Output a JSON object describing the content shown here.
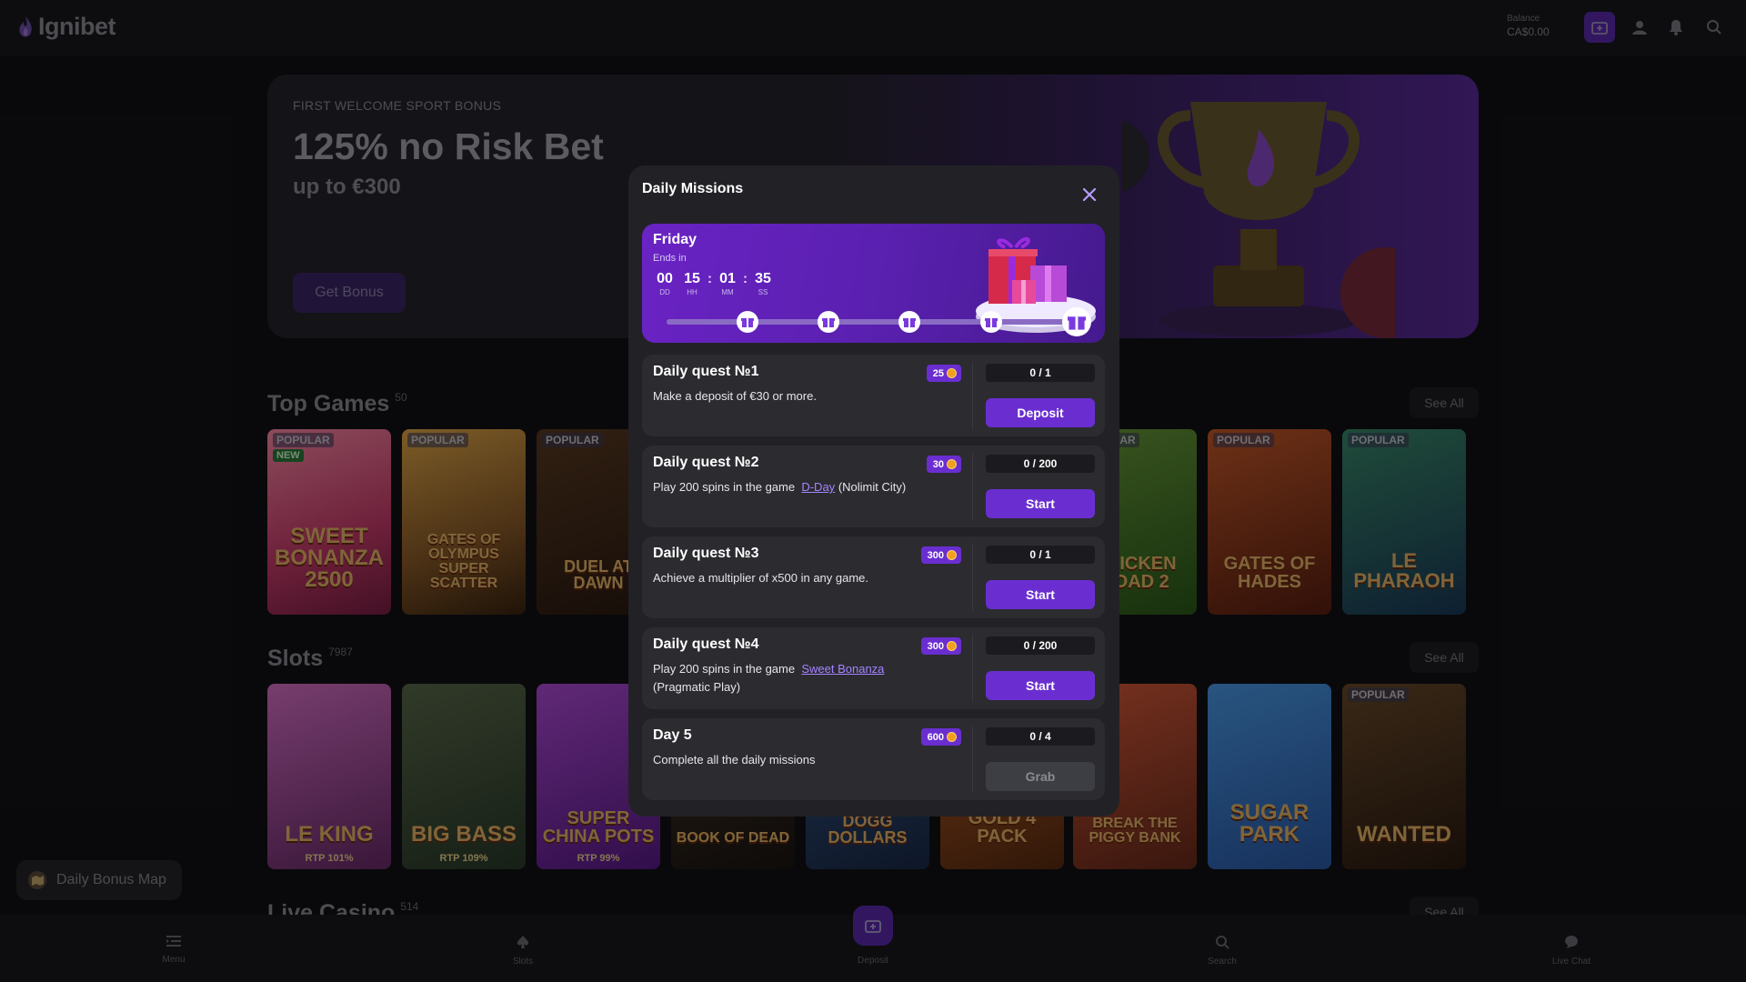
{
  "header": {
    "brand": "Ignibet",
    "balance_label": "Balance",
    "balance_value": "CA$0.00"
  },
  "banner": {
    "kicker": "FIRST WELCOME SPORT BONUS",
    "title": "125% no Risk Bet",
    "subtitle": "up to €300",
    "button": "Get Bonus"
  },
  "sections": {
    "top_games": {
      "title": "Top Games",
      "count": "50",
      "see_all": "See All"
    },
    "slots": {
      "title": "Slots",
      "count": "7987",
      "see_all": "See All"
    },
    "live_casino": {
      "title": "Live Casino",
      "count": "514",
      "see_all": "See All"
    }
  },
  "tiles": {
    "popular": "POPULAR",
    "new": "NEW",
    "top": [
      {
        "name": "SWEET BONANZA 2500"
      },
      {
        "name": "GATES OF OLYMPUS SUPER SCATTER"
      },
      {
        "name": "DUEL AT DAWN"
      },
      {
        "name": "CHICKEN ROAD 2"
      },
      {
        "name": "GATES OF HADES"
      },
      {
        "name": "LE PHARAOH"
      }
    ],
    "slots": [
      {
        "name": "LE KING",
        "rtp": "RTP 101%"
      },
      {
        "name": "BIG BASS",
        "rtp": "RTP 109%"
      },
      {
        "name": "SUPER CHINA POTS",
        "rtp": "RTP 99%"
      },
      {
        "name": "BOOK OF DEAD"
      },
      {
        "name": "DOGG DOLLARS"
      },
      {
        "name": "GOLD 4 PACK"
      },
      {
        "name": "BREAK THE PIGGY BANK"
      },
      {
        "name": "SUGAR PARK"
      },
      {
        "name": "WANTED"
      }
    ]
  },
  "daily_bonus_map": "Daily Bonus Map",
  "bottom_nav": {
    "menu": "Menu",
    "slots": "Slots",
    "deposit": "Deposit",
    "search": "Search",
    "live_chat": "Live Chat"
  },
  "modal": {
    "title": "Daily Missions",
    "day": "Friday",
    "ends_in": "Ends in",
    "timer": {
      "dd": "00",
      "dd_label": "DD",
      "hh": "15",
      "hh_label": "HH",
      "mm": "01",
      "mm_label": "MM",
      "ss": "35",
      "ss_label": "SS"
    },
    "quests": [
      {
        "title": "Daily quest №1",
        "reward": "25",
        "desc_text": "Make a deposit of €30 or more.",
        "progress": "0 / 1",
        "button": "Deposit"
      },
      {
        "title": "Daily quest №2",
        "reward": "30",
        "desc_prefix": "Play 200 spins in the game",
        "desc_link": "D-Day",
        "desc_suffix": "(Nolimit City)",
        "progress": "0 / 200",
        "button": "Start"
      },
      {
        "title": "Daily quest №3",
        "reward": "300",
        "desc_text": "Achieve a multiplier of x500 in any game.",
        "progress": "0 / 1",
        "button": "Start"
      },
      {
        "title": "Daily quest №4",
        "reward": "300",
        "desc_prefix": "Play 200 spins in the game",
        "desc_link": "Sweet Bonanza",
        "desc_suffix": "(Pragmatic Play)",
        "progress": "0 / 200",
        "button": "Start"
      },
      {
        "title": "Day 5",
        "reward": "600",
        "desc_text": "Complete all the daily missions",
        "progress": "0 / 4",
        "button": "Grab"
      }
    ]
  },
  "colors": {
    "accent": "#6a2ed0",
    "background": "#121215",
    "modal": "#222226",
    "card": "#2b2b30",
    "link": "#a584ff"
  }
}
